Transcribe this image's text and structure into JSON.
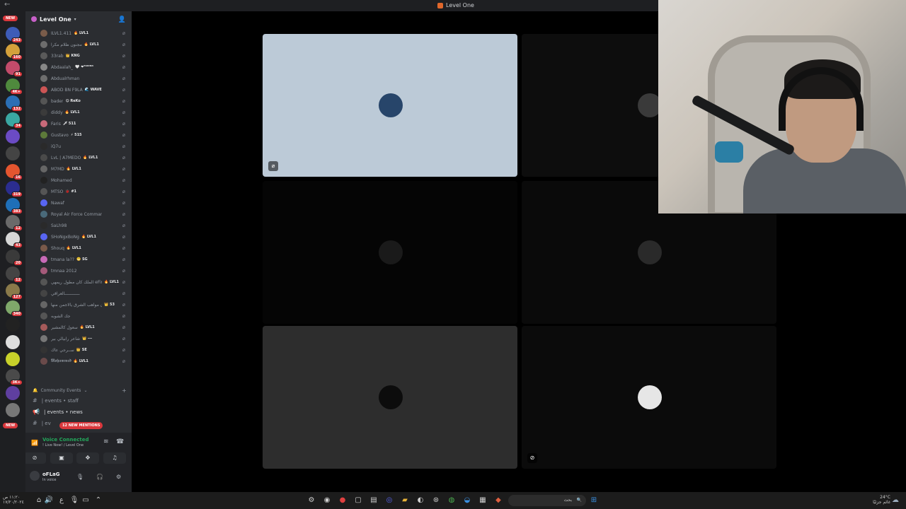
{
  "window": {
    "title": "Level One"
  },
  "guild": {
    "name": "Level One"
  },
  "rail": {
    "new_top": "NEW",
    "new_bottom": "NEW",
    "servers": [
      {
        "badge": "243",
        "color": "#3e5cb8"
      },
      {
        "badge": "160",
        "color": "#d4a13b"
      },
      {
        "badge": "91",
        "color": "#c24b6a"
      },
      {
        "badge": "4K+",
        "color": "#4f8a3d"
      },
      {
        "badge": "132",
        "color": "#2b6fb5"
      },
      {
        "badge": "34",
        "color": "#3aa7a2"
      },
      {
        "badge": "",
        "color": "#6b4bc4"
      },
      {
        "badge": "",
        "color": "#444"
      },
      {
        "badge": "16",
        "color": "#e4552f"
      },
      {
        "badge": "319",
        "color": "#2b2d8f"
      },
      {
        "badge": "383",
        "color": "#1f6fb8"
      },
      {
        "badge": "12",
        "color": "#6a6a6a"
      },
      {
        "badge": "43",
        "color": "#d7d7d7"
      },
      {
        "badge": "20",
        "color": "#3a3a3a"
      },
      {
        "badge": "12",
        "color": "#444"
      },
      {
        "badge": "127",
        "color": "#8a7a4a"
      },
      {
        "badge": "340",
        "color": "#7fa86a"
      },
      {
        "badge": "",
        "color": "#222"
      },
      {
        "badge": "",
        "color": "#ddd"
      },
      {
        "badge": "",
        "color": "#c8d12a"
      },
      {
        "badge": "3K+",
        "color": "#4a4a4a"
      },
      {
        "badge": "",
        "color": "#5f3fa0"
      },
      {
        "badge": "",
        "color": "#777"
      }
    ]
  },
  "members": [
    {
      "name": "ILVL1.411",
      "tag": "🔥 LVL1",
      "color": "#7a5c4a"
    },
    {
      "name": "مجنون ظلّام مكرا",
      "tag": "🔥 LVL1",
      "color": "#6d6d6d"
    },
    {
      "name": "33rab",
      "tag": "👑 KNG",
      "color": "#5a5a5a"
    },
    {
      "name": "Abdaalah_",
      "tag": "🤍 ❤︎ᵀᴬᴷᴵᴺᴳ",
      "color": "#888"
    },
    {
      "name": "Abdualrhman",
      "tag": "",
      "color": "#6e6e6e"
    },
    {
      "name": "ABOD BN F9LA",
      "tag": "🌊 WAVE",
      "color": "#c55"
    },
    {
      "name": "bader",
      "tag": "😋 ReKo",
      "color": "#555"
    },
    {
      "name": "diddy",
      "tag": "🔥 LVL1",
      "color": "#3b3b3b"
    },
    {
      "name": "Faris",
      "tag": "🗡 511",
      "color": "#c86a7a"
    },
    {
      "name": "Gustavo",
      "tag": "⚡ 515",
      "color": "#5d7a3a"
    },
    {
      "name": "iQ7u",
      "tag": "",
      "color": "#2a2a2a"
    },
    {
      "name": "LvL | A7MEDO",
      "tag": "🔥 LVL1",
      "color": "#4a4a4a"
    },
    {
      "name": "M7MD",
      "tag": "🔥 LVL1",
      "color": "#666"
    },
    {
      "name": "Mohamed",
      "tag": "",
      "color": "#222"
    },
    {
      "name": "MTSO",
      "tag": "🐞 #1",
      "color": "#555"
    },
    {
      "name": "Nawaf",
      "tag": "",
      "color": "#5865f2"
    },
    {
      "name": "Royal Air Force Commander",
      "tag": "",
      "color": "#4a6a7a"
    },
    {
      "name": "SaLh98",
      "tag": "",
      "color": "#2a2a2a"
    },
    {
      "name": "SHoNgxBoNg",
      "tag": "🔥 LVL1",
      "color": "#5865f2"
    },
    {
      "name": "Shouq",
      "tag": "🔥 LVL1",
      "color": "#7a5a4a"
    },
    {
      "name": "tmana la??",
      "tag": "😬 SG",
      "color": "#c86ab7"
    },
    {
      "name": "tmnaa 2012",
      "tag": "",
      "color": "#a55a7a"
    },
    {
      "name": "الملك كان مطول ريمهي eFiras",
      "tag": "🔥 LVL1",
      "color": "#555"
    },
    {
      "name": "ــــــــــــالعراقي",
      "tag": "",
      "color": "#444"
    },
    {
      "name": "المجنون مواهب الشرق يالاجمن منها",
      "tag": "👑 53",
      "color": "#666"
    },
    {
      "name": "جك الشوبه",
      "tag": "",
      "color": "#555"
    },
    {
      "name": "سعول كالمشير",
      "tag": "🔥 LVL1",
      "color": "#a55a5a"
    },
    {
      "name": "شاعر رابيالي بير",
      "tag": "👑 ---",
      "color": "#777"
    },
    {
      "name": "ســرجي عاك",
      "tag": "👑 SE",
      "color": "#333"
    },
    {
      "name": "𝕸𝖔𝖍𝖆𝖒𝖒𝖊𝖉",
      "tag": "🔥 LVL1",
      "color": "#6a4a4a"
    }
  ],
  "categories": {
    "community": "Community Events"
  },
  "channels": [
    {
      "name": "| events • staff",
      "icon": "#"
    },
    {
      "name": "| events • news",
      "icon": "📢"
    },
    {
      "name": "| ev",
      "icon": "#"
    }
  ],
  "mentions_pill": "12 NEW MENTIONS",
  "voice": {
    "status": "Voice Connected",
    "channel": "! Live Now! / Level One"
  },
  "user": {
    "name": "oFLaG",
    "status": "In voice"
  },
  "tiles": [
    {
      "bg": "#bccad7",
      "avatar": "#27456a"
    },
    {
      "bg": "#0d0d0d",
      "avatar": "#3a3a3a"
    },
    {
      "bg": "#050505",
      "avatar": "#1a1a1a"
    },
    {
      "bg": "#0a0a0a",
      "avatar": "#2a2a2a"
    },
    {
      "bg": "#2d2d2d",
      "avatar": "#0c0c0c"
    },
    {
      "bg": "#0b0b0b",
      "avatar": "#e6e6e6"
    }
  ],
  "taskbar": {
    "search_placeholder": "بحث",
    "weather": "24°C",
    "weather_sub": "غائم جزئيًا",
    "clock_time": "١١:٢٠ ص",
    "clock_date": "١٧/٢٠/٢٠٢٤"
  }
}
